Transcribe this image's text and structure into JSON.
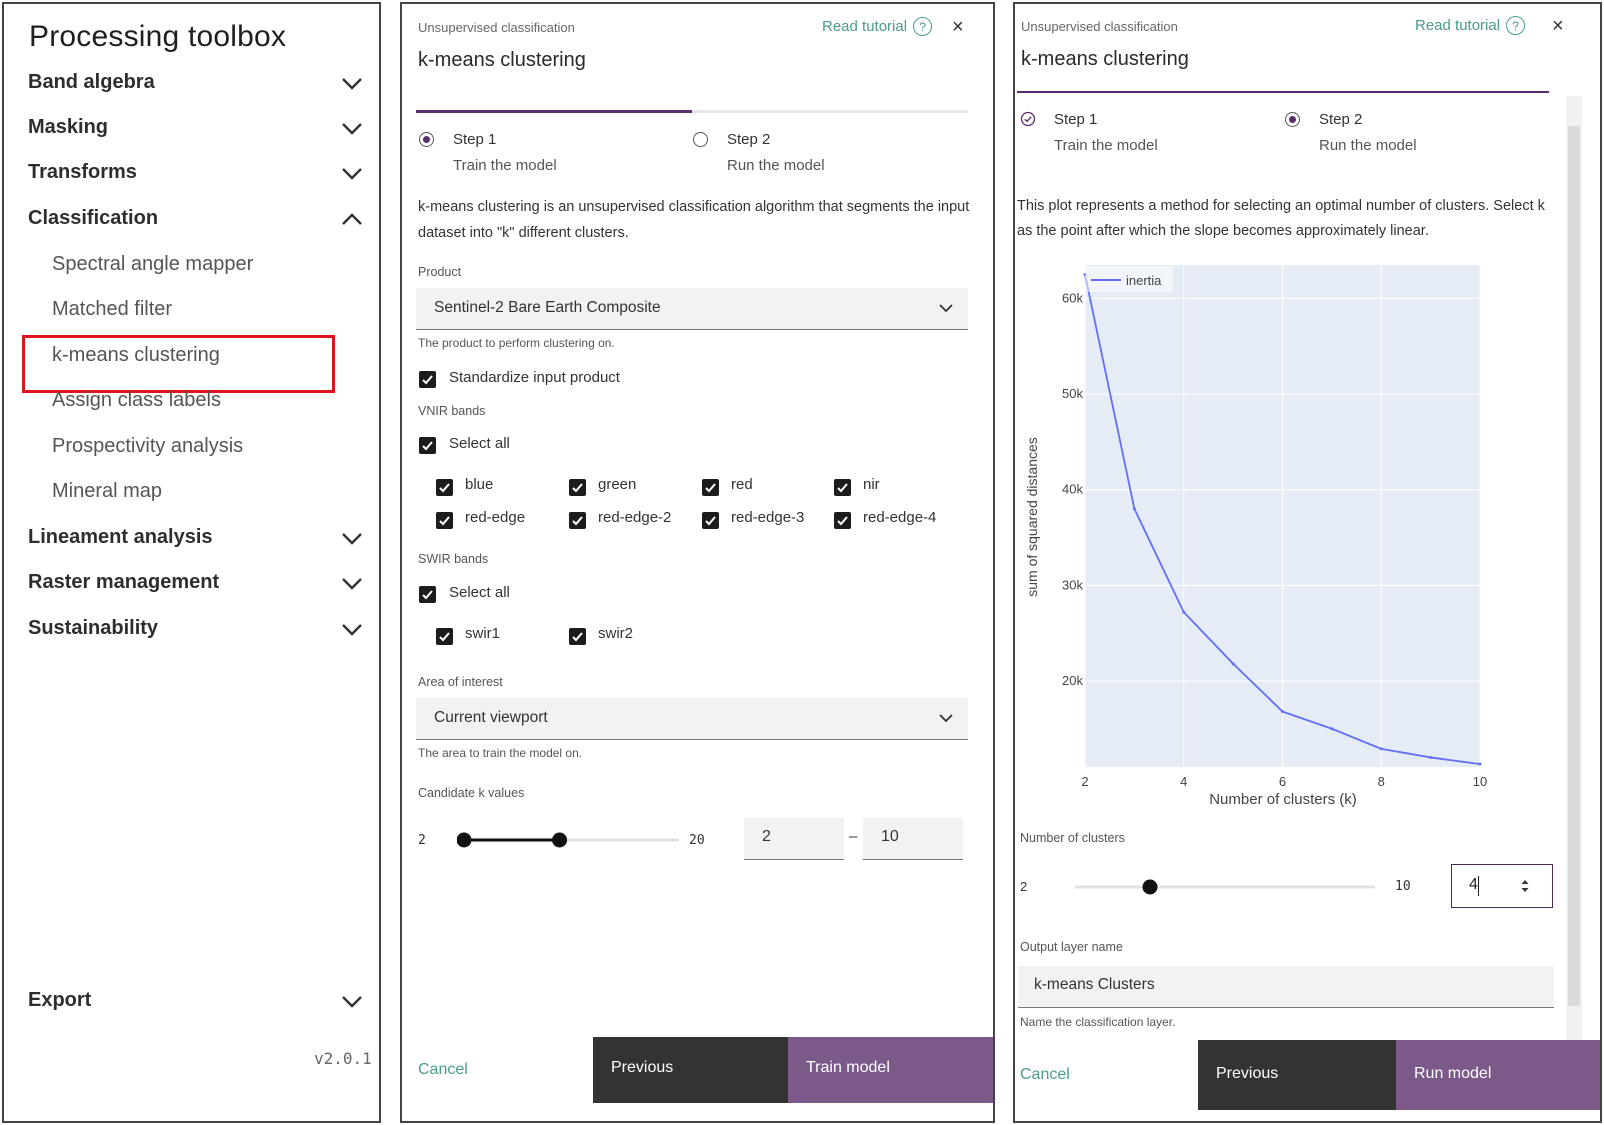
{
  "toolbox": {
    "title": "Processing toolbox",
    "categories": [
      {
        "label": "Band algebra",
        "expanded": false
      },
      {
        "label": "Masking",
        "expanded": false
      },
      {
        "label": "Transforms",
        "expanded": false
      },
      {
        "label": "Classification",
        "expanded": true
      },
      {
        "label": "Lineament analysis",
        "expanded": false
      },
      {
        "label": "Raster management",
        "expanded": false
      },
      {
        "label": "Sustainability",
        "expanded": false
      },
      {
        "label": "Export",
        "expanded": false
      }
    ],
    "classification_items": [
      "Spectral angle mapper",
      "Matched filter",
      "k-means clustering",
      "Assign class labels",
      "Prospectivity analysis",
      "Mineral map"
    ],
    "selected_item": "k-means clustering",
    "version": "v2.0.1",
    "highlight_color": "#e0141c"
  },
  "step1": {
    "header_sub": "Unsupervised classification",
    "header_title": "k-means clustering",
    "tutorial": "Read tutorial",
    "close": "×",
    "steps": [
      {
        "title": "Step 1",
        "subtitle": "Train the model",
        "state": "active"
      },
      {
        "title": "Step 2",
        "subtitle": "Run the model",
        "state": "inactive"
      }
    ],
    "description": "k-means clustering is an unsupervised classification algorithm that segments the input dataset into \"k\" different clusters.",
    "product_label": "Product",
    "product_value": "Sentinel-2 Bare Earth Composite",
    "product_help": "The product to perform clustering on.",
    "standardize_label": "Standardize input product",
    "vnir_label": "VNIR bands",
    "select_all": "Select all",
    "vnir_bands": [
      "blue",
      "green",
      "red",
      "nir",
      "red-edge",
      "red-edge-2",
      "red-edge-3",
      "red-edge-4"
    ],
    "swir_label": "SWIR bands",
    "swir_bands": [
      "swir1",
      "swir2"
    ],
    "aoi_label": "Area of interest",
    "aoi_value": "Current viewport",
    "aoi_help": "The area to train the model on.",
    "k_label": "Candidate k values",
    "k_min": "2",
    "k_max": "20",
    "k_low": "2",
    "k_high": "10",
    "range_sep": "–",
    "range_low_value": 2,
    "range_high_value": 10,
    "cancel": "Cancel",
    "previous": "Previous",
    "primary": "Train model",
    "accent": "#5a2e6e",
    "primary_bg": "#7b5a8a",
    "dark_bg": "#333333"
  },
  "step2": {
    "header_sub": "Unsupervised classification",
    "header_title": "k-means clustering",
    "tutorial": "Read tutorial",
    "close": "×",
    "steps": [
      {
        "title": "Step 1",
        "subtitle": "Train the model",
        "state": "done"
      },
      {
        "title": "Step 2",
        "subtitle": "Run the model",
        "state": "active"
      }
    ],
    "description": "This plot represents a method for selecting an optimal number of clusters. Select k as the point after which the slope becomes approximately linear.",
    "clusters_label": "Number of clusters",
    "clusters_min": "2",
    "clusters_max": "10",
    "clusters_value": "4",
    "output_label": "Output layer name",
    "output_value": "k-means Clusters",
    "output_help": "Name the classification layer.",
    "cancel": "Cancel",
    "previous": "Previous",
    "primary": "Run model"
  },
  "chart_data": {
    "type": "line",
    "x": [
      2,
      3,
      4,
      5,
      6,
      7,
      8,
      9,
      10
    ],
    "series": [
      {
        "name": "inertia",
        "values": [
          62500,
          38000,
          27200,
          21800,
          16800,
          15000,
          12900,
          12000,
          11300
        ],
        "color": "#636efa"
      }
    ],
    "xlabel": "Number of clusters (k)",
    "ylabel": "sum of squared distances",
    "xticks": [
      "2",
      "4",
      "6",
      "8",
      "10"
    ],
    "yticks": [
      "20k",
      "30k",
      "40k",
      "50k",
      "60k"
    ],
    "xlim": [
      2,
      10
    ],
    "ylim": [
      11000,
      63500
    ],
    "legend_position": "top-left",
    "plot_bg": "#e5ecf6"
  }
}
